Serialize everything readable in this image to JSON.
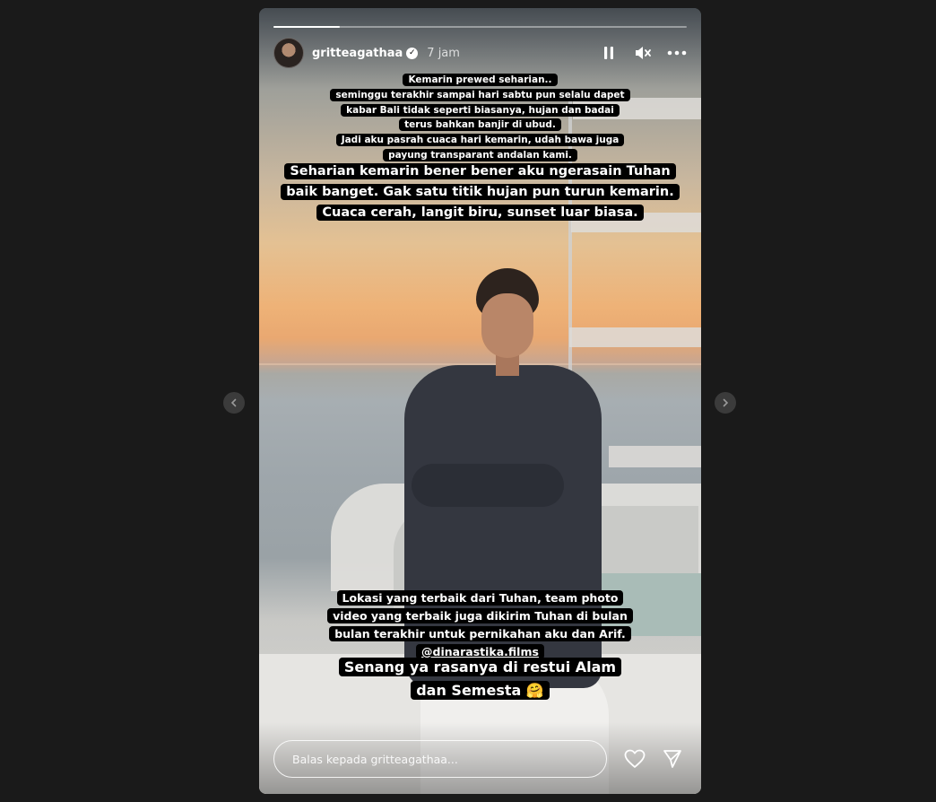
{
  "story": {
    "progress": 0.16,
    "user": {
      "username": "gritteagathaa",
      "verified": true,
      "time": "7 jam"
    },
    "header_icons": [
      "pause-icon",
      "mute-icon",
      "more-icon"
    ],
    "captions": {
      "intro": [
        "Kemarin prewed seharian..",
        "seminggu terakhir sampai hari sabtu pun selalu dapet",
        "kabar Bali tidak seperti biasanya, hujan dan badai",
        "terus bahkan banjir di ubud.",
        "Jadi aku pasrah cuaca hari kemarin, udah bawa juga",
        "payung transparant andalan kami."
      ],
      "highlight": [
        "Seharian kemarin bener bener aku ngerasain Tuhan",
        "baik banget. Gak satu titik hujan pun turun kemarin.",
        "Cuaca cerah, langit biru, sunset luar biasa."
      ],
      "location": [
        "Lokasi yang terbaik dari Tuhan, team photo",
        "video yang terbaik juga dikirim Tuhan di bulan",
        "bulan terakhir untuk pernikahan aku dan Arif."
      ],
      "mention": "@dinarastika.films",
      "closing": [
        "Senang ya rasanya di restui Alam",
        "dan Semesta 🤗"
      ]
    },
    "reply": {
      "placeholder": "Balas kepada gritteagathaa..."
    }
  },
  "navigation": {
    "prev_icon": "chevron-left-icon",
    "next_icon": "chevron-right-icon"
  },
  "colors": {
    "background": "#1a1a1a",
    "caption_bg": "#000000",
    "text": "#ffffff"
  }
}
